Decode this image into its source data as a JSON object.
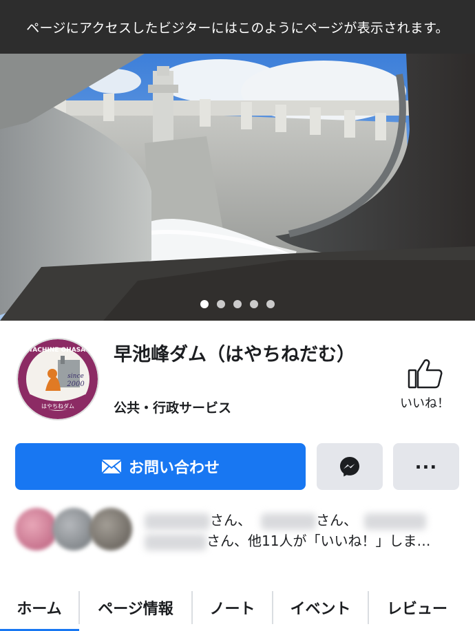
{
  "banner": {
    "text": "ページにアクセスしたビジターにはこのようにページが表示されます。"
  },
  "cover": {
    "slide_count": 5,
    "active_slide": 1
  },
  "page": {
    "title": "早池峰ダム（はやちねだむ）",
    "category": "公共・行政サービス",
    "avatar": {
      "top_text": "HAYACHINE OHASAMA",
      "since": "since",
      "year": "2000",
      "bottom_text": "はやちねダム"
    }
  },
  "like_button": {
    "label": "いいね！",
    "icon": "thumbs-up-icon"
  },
  "actions": {
    "contact_label": "お問い合わせ",
    "contact_icon": "envelope-icon",
    "messenger_icon": "messenger-icon",
    "more_label": "..."
  },
  "friends": {
    "line1_san_a": "さん、",
    "line1_san_b": "さん、",
    "line2_san": "さん、",
    "line2_rest": "他11人が「いいね！」しま…"
  },
  "tabs": [
    {
      "label": "ホーム"
    },
    {
      "label": "ページ情報"
    },
    {
      "label": "ノート"
    },
    {
      "label": "イベント"
    },
    {
      "label": "レビュー"
    }
  ],
  "colors": {
    "primary": "#1877f2",
    "secondary_button": "#e4e6eb",
    "banner_bg": "#2d2d2d"
  }
}
